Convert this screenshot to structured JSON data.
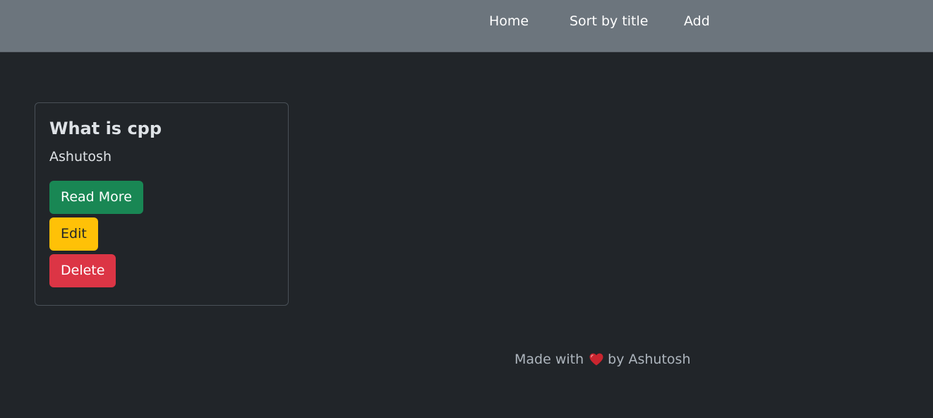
{
  "navbar": {
    "links": [
      {
        "label": "Home"
      },
      {
        "label": "Sort by title"
      },
      {
        "label": "Add"
      }
    ]
  },
  "card": {
    "title": "What is cpp",
    "author": "Ashutosh",
    "buttons": {
      "read_more": "Read More",
      "edit": "Edit",
      "delete": "Delete"
    }
  },
  "footer": {
    "prefix": "Made with",
    "icon": "heart-icon",
    "suffix": "by Ashutosh"
  },
  "colors": {
    "background": "#212529",
    "navbar": "#6c757d",
    "success": "#198754",
    "warning": "#ffc107",
    "danger": "#dc3545",
    "heart": "#c9252f"
  }
}
